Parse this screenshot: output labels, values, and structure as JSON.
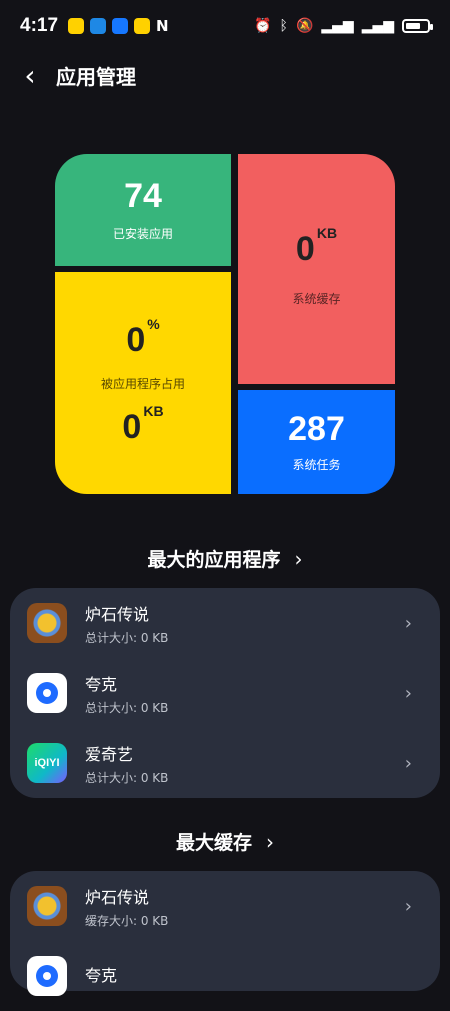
{
  "status_bar": {
    "time": "4:17",
    "icons": [
      "meituan-icon",
      "message-icon",
      "alipay-icon",
      "meituan-icon",
      "nfc-icon",
      "alarm-icon",
      "bluetooth-icon",
      "mute-icon",
      "signal-icon",
      "signal-icon",
      "battery-icon"
    ]
  },
  "header": {
    "title": "应用管理"
  },
  "stats": {
    "installed_value": "74",
    "installed_label": "已安装应用",
    "cache_value": "0",
    "cache_unit": "KB",
    "cache_label": "系统缓存",
    "app_percent_value": "0",
    "app_percent_unit": "%",
    "app_usage_label": "被应用程序占用",
    "app_size_value": "0",
    "app_size_unit": "KB",
    "tasks_value": "287",
    "tasks_label": "系统任务"
  },
  "largest_apps": {
    "title": "最大的应用程序",
    "items": [
      {
        "name": "炉石传说",
        "detail": "总计大小: 0 KB",
        "icon": "hearthstone-icon"
      },
      {
        "name": "夸克",
        "detail": "总计大小: 0 KB",
        "icon": "quark-icon"
      },
      {
        "name": "爱奇艺",
        "detail": "总计大小: 0 KB",
        "icon": "iqiyi-icon",
        "icon_text": "iQIYI"
      }
    ]
  },
  "largest_cache": {
    "title": "最大缓存",
    "items": [
      {
        "name": "炉石传说",
        "detail": "缓存大小: 0 KB",
        "icon": "hearthstone-icon"
      },
      {
        "name": "夸克",
        "detail": "",
        "icon": "quark-icon"
      }
    ]
  },
  "colors": {
    "green": "#37B57C",
    "yellow": "#FFD800",
    "red": "#F25F5F",
    "blue": "#0A6EFF",
    "card": "#2A2F3D",
    "background": "#121217"
  }
}
